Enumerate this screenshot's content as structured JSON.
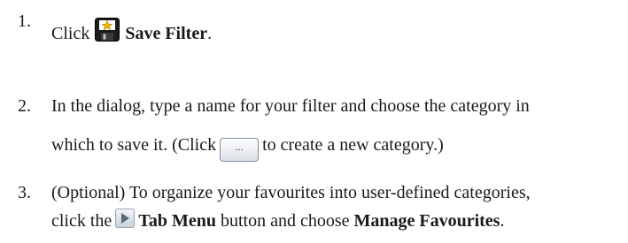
{
  "steps": [
    {
      "number": "1.",
      "before_icon": "Click",
      "icon": "save-filter-icon",
      "bold": "Save Filter",
      "after": "."
    },
    {
      "number": "2.",
      "line1": "In the dialog, type a name for your filter and choose the category in",
      "line2_before": "which to save it. (Click",
      "button_label": "...",
      "line2_after": "to create a new category.)"
    },
    {
      "number": "3.",
      "line1": "(Optional) To organize your favourites into user-defined categories,",
      "line2_before": "click the",
      "icon": "tab-menu-icon",
      "bold_1": "Tab Menu",
      "middle": "button and choose",
      "bold_2": "Manage Favourites",
      "after": "."
    }
  ]
}
